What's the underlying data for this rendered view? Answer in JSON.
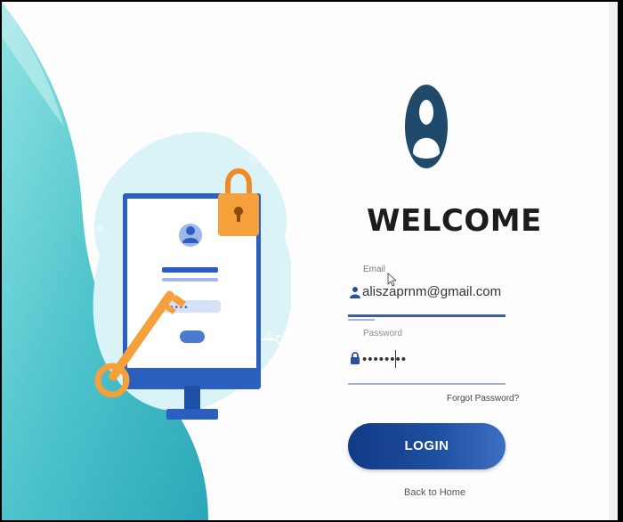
{
  "login": {
    "title": "WELCOME",
    "email": {
      "label": "Email",
      "value": "aliszaprnm@gmail.com",
      "icon": "user-icon"
    },
    "password": {
      "label": "Password",
      "masked_value": "••••••••",
      "icon": "lock-icon"
    },
    "forgot_link": "Forgot Password?",
    "login_button": "LOGIN",
    "back_link": "Back to Home"
  },
  "colors": {
    "accent": "#1d4fa0",
    "teal": "#5ccfd4",
    "avatar": "#1f4a6b",
    "lock": "#f5a03a"
  },
  "icons": {
    "avatar": "avatar-icon",
    "illustration": "computer-lock-key-illustration"
  }
}
